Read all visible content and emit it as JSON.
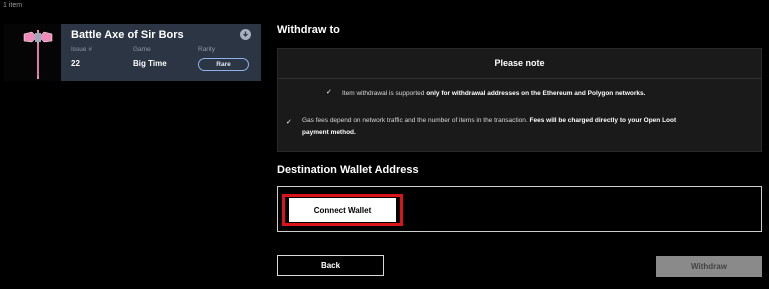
{
  "header": {
    "item_count": "1 item"
  },
  "item": {
    "name": "Battle Axe of Sir Bors",
    "issue_label": "Issue #",
    "issue_value": "22",
    "game_label": "Game",
    "game_value": "Big Time",
    "rarity_label": "Rarity",
    "rarity_value": "Rare",
    "icons": {
      "download": "download-icon",
      "thumbnail": "battle-axe-image"
    },
    "colors": {
      "card_bg": "#2b3544",
      "rarity_border": "#8fb0e8",
      "axe_pink": "#f08ab8"
    }
  },
  "withdraw": {
    "heading": "Withdraw to",
    "note": {
      "title": "Please note",
      "line1_prefix": "Item withdrawal is supported ",
      "line1_bold": "only for withdrawal addresses on the Ethereum and Polygon networks.",
      "line2_prefix": "Gas fees depend on network traffic and the number of items in the transaction. ",
      "line2_bold_a": "Fees will be charged directly to your Open Loot",
      "line2_bold_b": "payment method."
    },
    "destination_heading": "Destination Wallet Address",
    "connect_button": "Connect Wallet",
    "highlight_color": "#d9141b"
  },
  "footer": {
    "back_button": "Back",
    "withdraw_button": "Withdraw"
  }
}
